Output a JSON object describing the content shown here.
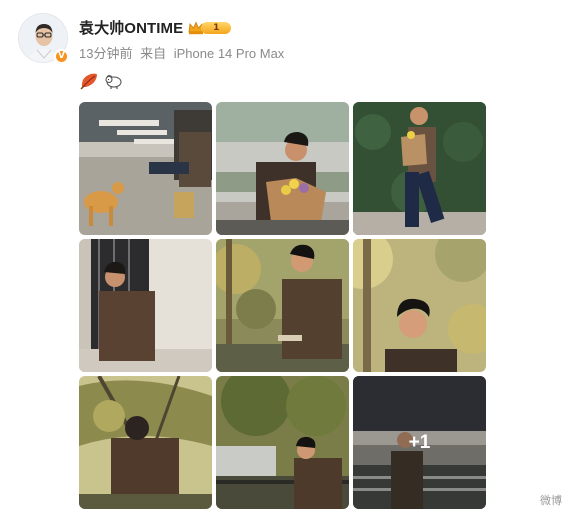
{
  "post": {
    "author": {
      "name": "袁大帅ONTIME",
      "avatar_icon": "person-avatar-icon",
      "verified_icon": "verified-v-icon",
      "verified_text": "V",
      "vip_level": "1",
      "vip_icon": "crown-icon"
    },
    "meta": {
      "time": "13分钟前",
      "source_prefix": "来自",
      "device": "iPhone 14 Pro Max"
    },
    "emojis": [
      "leaf-emoji",
      "lamb-emoji"
    ],
    "photos": [
      {
        "icon": "photo-cafe-dog",
        "description_name": "photo-1"
      },
      {
        "icon": "photo-flowers-bridge",
        "description_name": "photo-2"
      },
      {
        "icon": "photo-hedge-walk",
        "description_name": "photo-3"
      },
      {
        "icon": "photo-window-wall",
        "description_name": "photo-4"
      },
      {
        "icon": "photo-river-rail",
        "description_name": "photo-5"
      },
      {
        "icon": "photo-look-up",
        "description_name": "photo-6"
      },
      {
        "icon": "photo-trees-back",
        "description_name": "photo-7"
      },
      {
        "icon": "photo-trees-bench",
        "description_name": "photo-8"
      },
      {
        "icon": "photo-riverside-dusk",
        "description_name": "photo-9"
      }
    ],
    "more_label": "+1",
    "watermark": "微博"
  }
}
